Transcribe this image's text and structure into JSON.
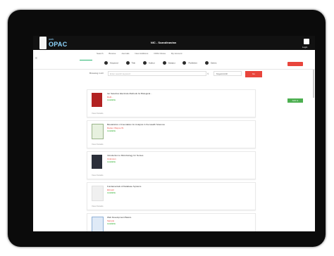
{
  "app": {
    "small": "web",
    "big": "OPAC"
  },
  "header": {
    "title": "NIC - Scandinavian",
    "user_label": "Login"
  },
  "nav": [
    "Search",
    "Browse",
    "Journals",
    "New Additions",
    "OPAC Rules",
    "My Account"
  ],
  "search_types": [
    "Keyword",
    "Title",
    "Author",
    "Subject",
    "Publisher",
    "Series"
  ],
  "browse": {
    "label": "Browsing in All",
    "placeholder": "Enter search keyword",
    "select": "Keyword All",
    "go": "Go"
  },
  "results": [
    {
      "title": "Ion Selective Electrode Methods for Biological...",
      "author": "Ruth...",
      "status": "Available"
    },
    {
      "title": "Biostatistics: A Foundation for Analysis in the Health Sciences",
      "author": "Daniel, Wayne W.",
      "status": "Available"
    },
    {
      "title": "Introduction to Microbiology for Nurses",
      "author": "Unknown",
      "status": "Available"
    },
    {
      "title": "Fundamentals of Database Systems",
      "author": "Elmasri",
      "status": "Available"
    },
    {
      "title": "Web Development Basics",
      "author": "Sample",
      "status": "Available"
    }
  ],
  "more_label": "View Details",
  "right_green": "Add to",
  "red_top": "Reset",
  "colors": {
    "accent_red": "#e8453c",
    "accent_green": "#4caf50",
    "topbar": "#111111"
  }
}
